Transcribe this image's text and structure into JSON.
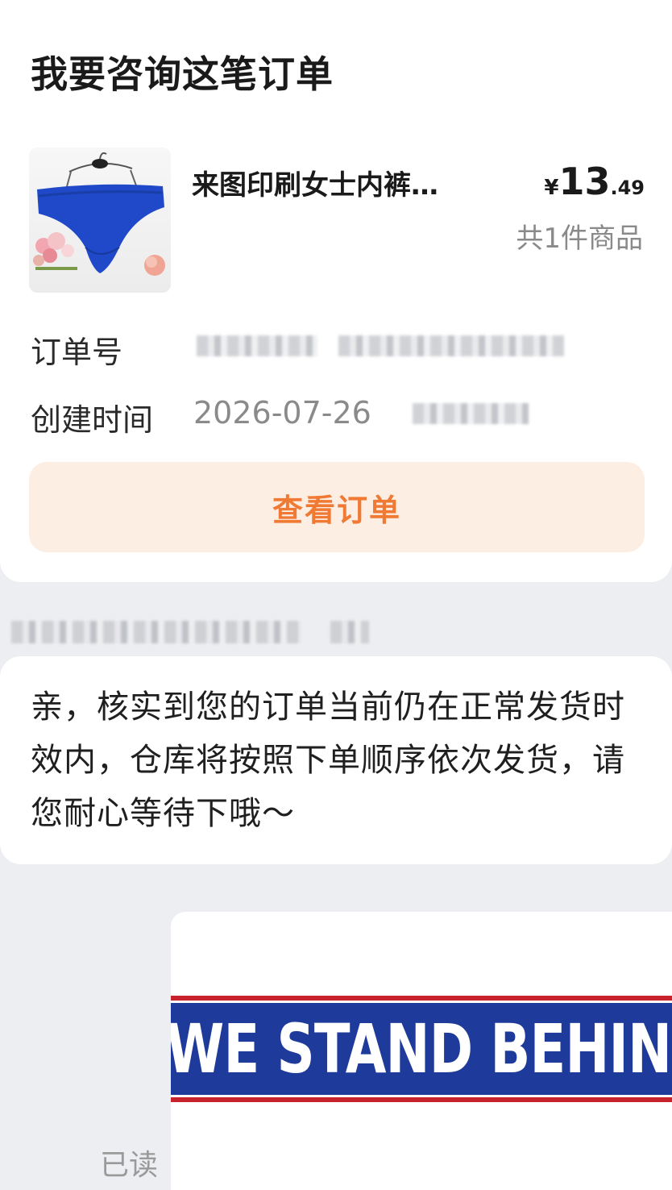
{
  "order_card": {
    "title": "我要咨询这笔订单",
    "product": {
      "name": "来图印刷女士内裤…",
      "price_currency": "¥",
      "price_integer": "13",
      "price_decimal": ".49",
      "item_count": "共1件商品"
    },
    "order_number_label": "订单号",
    "created_time_label": "创建时间",
    "created_date": "2026-07-26",
    "view_order_button": "查看订单"
  },
  "message": {
    "text": "亲，核实到您的订单当前仍在正常发货时效内，仓库将按照下单顺序依次发货，请您耐心等待下哦～"
  },
  "image_message": {
    "banner_text": "WE STAND BEHIND"
  },
  "read_status": "已读",
  "colors": {
    "accent_orange": "#f07a34",
    "button_bg": "#fdeee4",
    "banner_blue": "#1e3a9a",
    "banner_red": "#c8232c"
  }
}
